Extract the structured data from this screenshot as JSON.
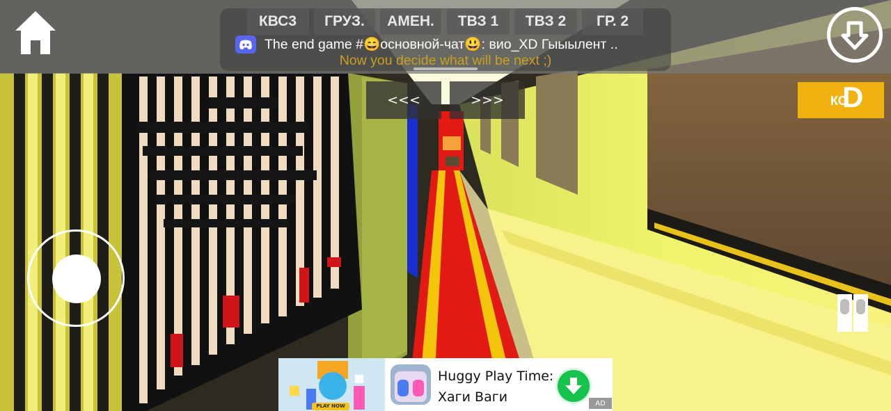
{
  "top_bar": {
    "tabs": [
      "КВС3",
      "ГРУЗ.",
      "АМЕН.",
      "ТВЗ 1",
      "ТВЗ 2",
      "ГР. 2"
    ],
    "chat_message": "The end game #😄основной-чат😃: вио_XD  Гыыылент ..",
    "chat_subtitle": "Now you decide what will be next ;)",
    "home_icon": "home-icon",
    "share_icon": "download-arrow-icon"
  },
  "navigation": {
    "prev_label": "<<<",
    "next_label": ">>>"
  },
  "yellow_button": {
    "label": "КС",
    "overlay_letter": "D",
    "color": "#f1b20f"
  },
  "ad": {
    "title": "Huggy Play Time: Хаги Ваги",
    "left_cta": "PLAY NOW",
    "badge": "AD",
    "download_color": "#17c34d"
  },
  "colors": {
    "carpet_red": "#e21a13",
    "carpet_stripe": "#f3c50b",
    "wall_yellow": "#f4f070"
  }
}
